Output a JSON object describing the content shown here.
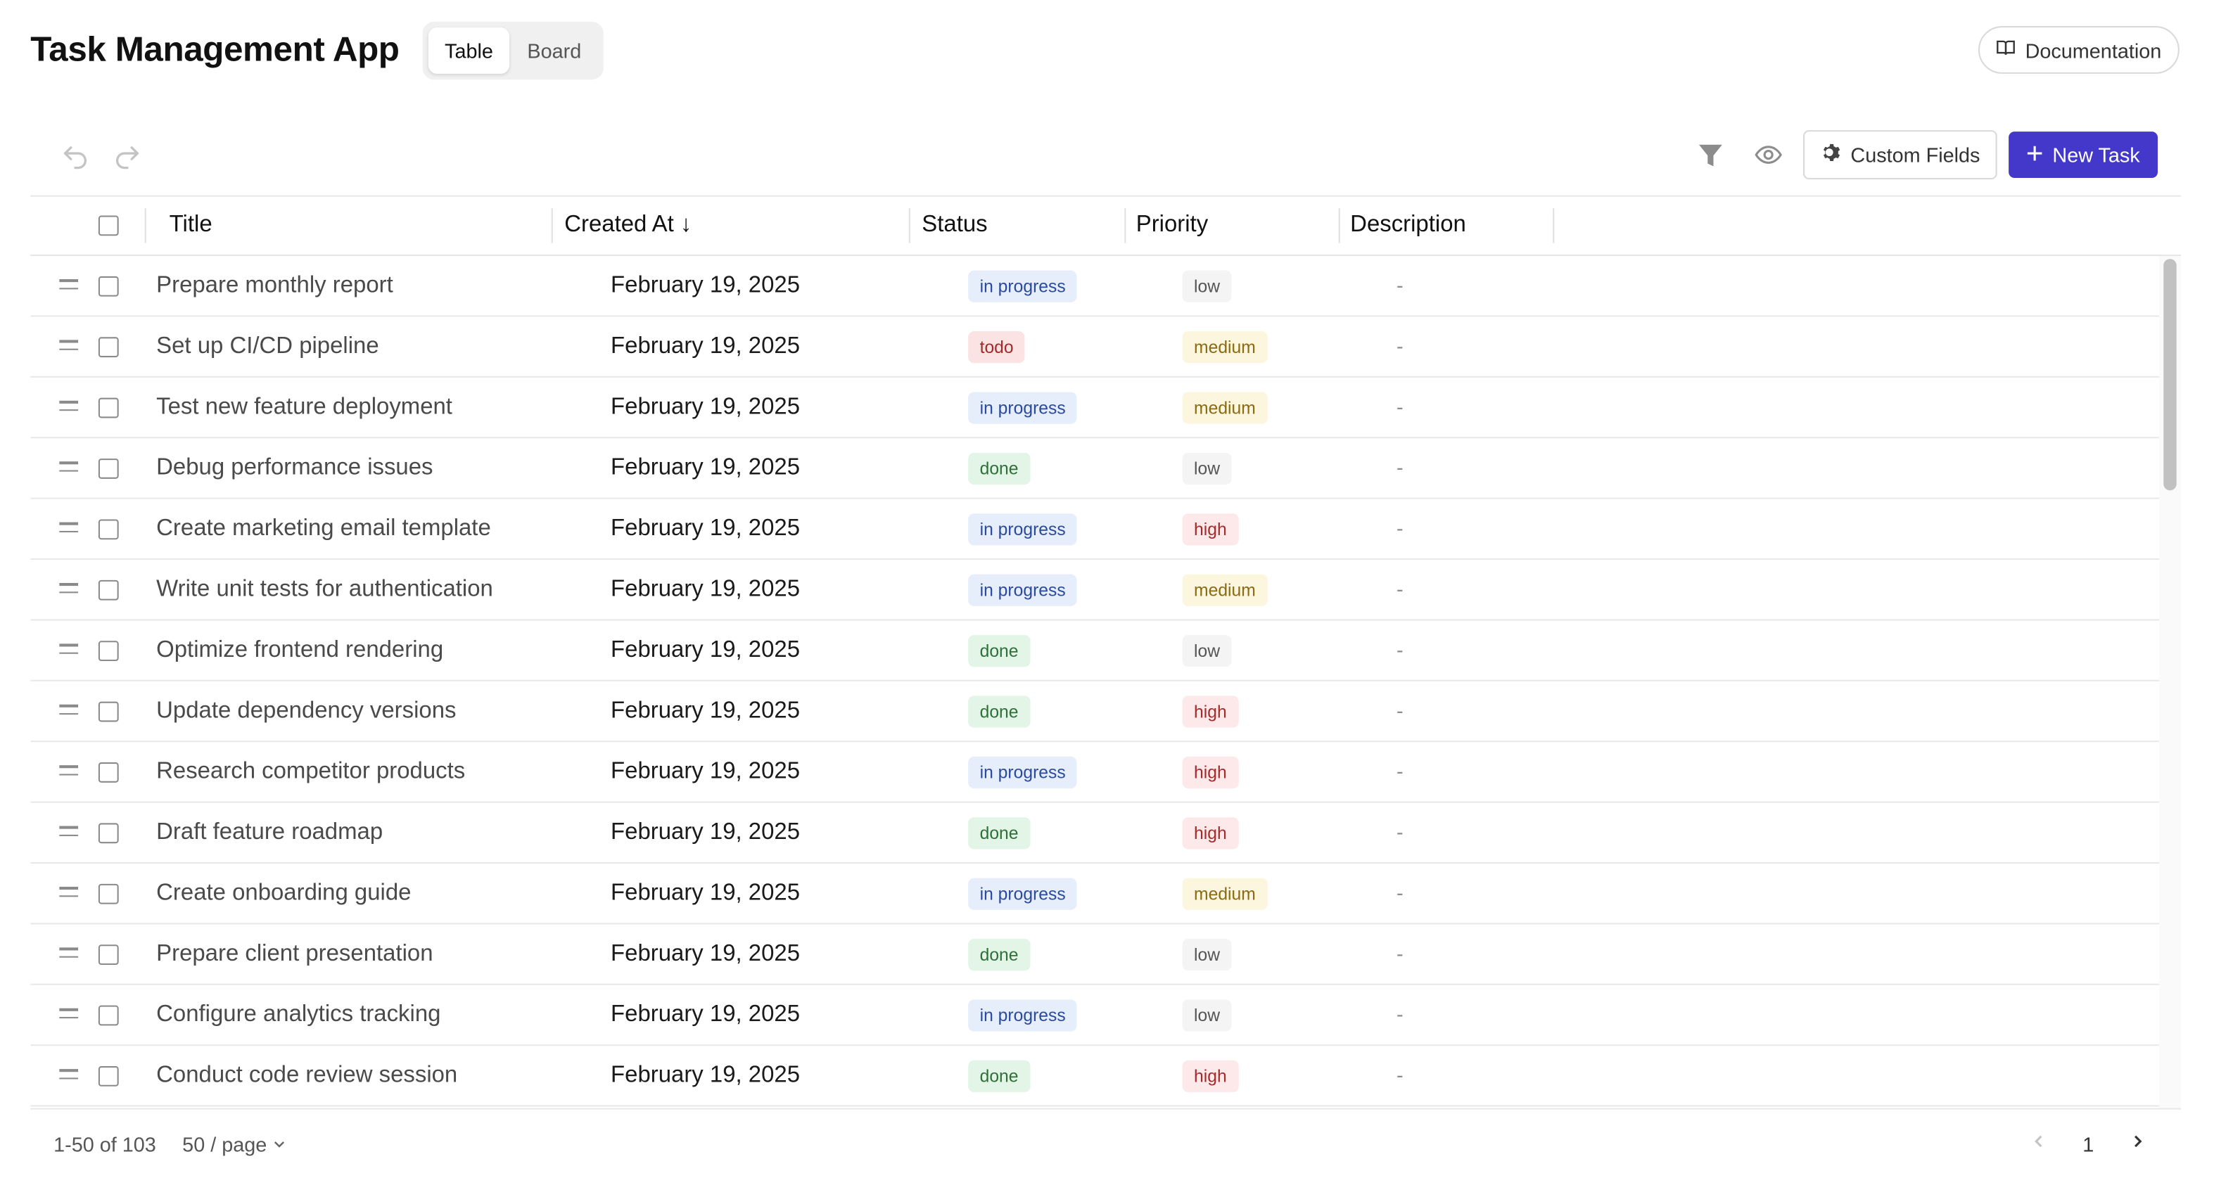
{
  "header": {
    "title": "Task Management App",
    "view_toggle": [
      {
        "label": "Table",
        "active": true
      },
      {
        "label": "Board",
        "active": false
      }
    ],
    "documentation_label": "Documentation"
  },
  "toolbar": {
    "custom_fields_label": "Custom Fields",
    "new_task_label": "New Task",
    "icons": [
      "undo-icon",
      "redo-icon",
      "filter-icon",
      "eye-icon",
      "gear-icon",
      "plus-icon"
    ]
  },
  "table": {
    "columns": [
      "Title",
      "Created At ↓",
      "Status",
      "Priority",
      "Description"
    ],
    "rows": [
      {
        "title": "Prepare monthly report",
        "created_at": "February 19, 2025",
        "status": "in progress",
        "priority": "low",
        "description": "-"
      },
      {
        "title": "Set up CI/CD pipeline",
        "created_at": "February 19, 2025",
        "status": "todo",
        "priority": "medium",
        "description": "-"
      },
      {
        "title": "Test new feature deployment",
        "created_at": "February 19, 2025",
        "status": "in progress",
        "priority": "medium",
        "description": "-"
      },
      {
        "title": "Debug performance issues",
        "created_at": "February 19, 2025",
        "status": "done",
        "priority": "low",
        "description": "-"
      },
      {
        "title": "Create marketing email template",
        "created_at": "February 19, 2025",
        "status": "in progress",
        "priority": "high",
        "description": "-"
      },
      {
        "title": "Write unit tests for authentication",
        "created_at": "February 19, 2025",
        "status": "in progress",
        "priority": "medium",
        "description": "-"
      },
      {
        "title": "Optimize frontend rendering",
        "created_at": "February 19, 2025",
        "status": "done",
        "priority": "low",
        "description": "-"
      },
      {
        "title": "Update dependency versions",
        "created_at": "February 19, 2025",
        "status": "done",
        "priority": "high",
        "description": "-"
      },
      {
        "title": "Research competitor products",
        "created_at": "February 19, 2025",
        "status": "in progress",
        "priority": "high",
        "description": "-"
      },
      {
        "title": "Draft feature roadmap",
        "created_at": "February 19, 2025",
        "status": "done",
        "priority": "high",
        "description": "-"
      },
      {
        "title": "Create onboarding guide",
        "created_at": "February 19, 2025",
        "status": "in progress",
        "priority": "medium",
        "description": "-"
      },
      {
        "title": "Prepare client presentation",
        "created_at": "February 19, 2025",
        "status": "done",
        "priority": "low",
        "description": "-"
      },
      {
        "title": "Configure analytics tracking",
        "created_at": "February 19, 2025",
        "status": "in progress",
        "priority": "low",
        "description": "-"
      },
      {
        "title": "Conduct code review session",
        "created_at": "February 19, 2025",
        "status": "done",
        "priority": "high",
        "description": "-"
      }
    ]
  },
  "tag_colors": {
    "status": {
      "in progress": {
        "bg": "#e6edfb",
        "fg": "#2a4a9b"
      },
      "todo": {
        "bg": "#fbe3e3",
        "fg": "#a12b2b"
      },
      "done": {
        "bg": "#e3f5e6",
        "fg": "#2f6f3a"
      }
    },
    "priority": {
      "low": {
        "bg": "#f4f4f4",
        "fg": "#555555"
      },
      "medium": {
        "bg": "#fdf6df",
        "fg": "#8a6a12"
      },
      "high": {
        "bg": "#fde9e9",
        "fg": "#a32b2b"
      }
    }
  },
  "footer": {
    "range_text": "1-50 of 103",
    "page_size_label": "50 / page",
    "current_page": "1"
  },
  "colors": {
    "primary": "#4338ca"
  }
}
